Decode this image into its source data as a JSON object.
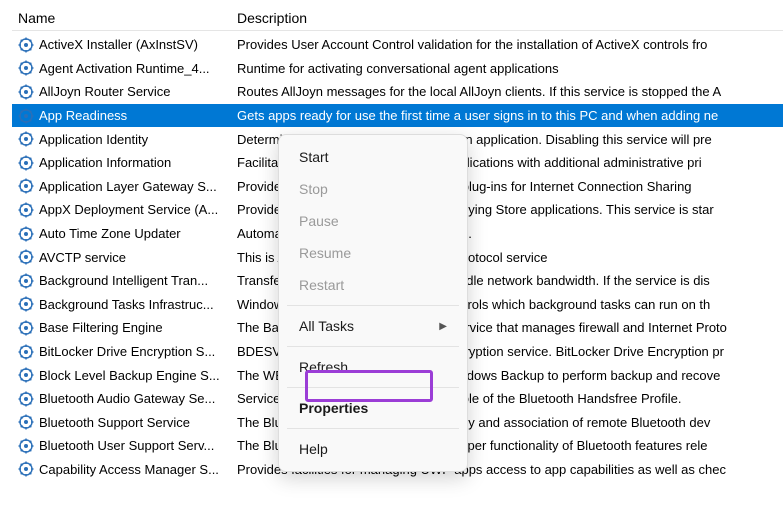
{
  "columns": {
    "name": "Name",
    "description": "Description"
  },
  "services": [
    {
      "name": "ActiveX Installer (AxInstSV)",
      "description": "Provides User Account Control validation for the installation of ActiveX controls fro"
    },
    {
      "name": "Agent Activation Runtime_4...",
      "description": "Runtime for activating conversational agent applications"
    },
    {
      "name": "AllJoyn Router Service",
      "description": "Routes AllJoyn messages for the local AllJoyn clients. If this service is stopped the A"
    },
    {
      "name": "App Readiness",
      "description": "Gets apps ready for use the first time a user signs in to this PC and when adding ne",
      "selected": true
    },
    {
      "name": "Application Identity",
      "description": "Determines and verifies the identity of an application. Disabling this service will pre"
    },
    {
      "name": "Application Information",
      "description": "Facilitates the running of interactive applications with additional administrative pri"
    },
    {
      "name": "Application Layer Gateway S...",
      "description": "Provides support for 3rd party protocol plug-ins for Internet Connection Sharing"
    },
    {
      "name": "AppX Deployment Service (A...",
      "description": "Provides infrastructure support for deploying Store applications. This service is star"
    },
    {
      "name": "Auto Time Zone Updater",
      "description": "Automatically sets the system time zone."
    },
    {
      "name": "AVCTP service",
      "description": "This is Audio Video Control Transport Protocol service"
    },
    {
      "name": "Background Intelligent Tran...",
      "description": "Transfers files in the background using idle network bandwidth. If the service is dis"
    },
    {
      "name": "Background Tasks Infrastruc...",
      "description": "Windows infrastructure service that controls which background tasks can run on th"
    },
    {
      "name": "Base Filtering Engine",
      "description": "The Base Filtering Engine (BFE) is a service that manages firewall and Internet Proto"
    },
    {
      "name": "BitLocker Drive Encryption S...",
      "description": "BDESVC hosts the BitLocker Drive Encryption service. BitLocker Drive Encryption pr"
    },
    {
      "name": "Block Level Backup Engine S...",
      "description": "The WBENGINE service is used by Windows Backup to perform backup and recove"
    },
    {
      "name": "Bluetooth Audio Gateway Se...",
      "description": "Service supporting the audio gateway role of the Bluetooth Handsfree Profile."
    },
    {
      "name": "Bluetooth Support Service",
      "description": "The Bluetooth service supports discovery and association of remote Bluetooth dev"
    },
    {
      "name": "Bluetooth User Support Serv...",
      "description": "The Bluetooth user service supports proper functionality of Bluetooth features rele"
    },
    {
      "name": "Capability Access Manager S...",
      "description": "Provides facilities for managing UWP apps access to app capabilities as well as chec"
    }
  ],
  "context_menu": {
    "start": "Start",
    "stop": "Stop",
    "pause": "Pause",
    "resume": "Resume",
    "restart": "Restart",
    "all_tasks": "All Tasks",
    "refresh": "Refresh",
    "properties": "Properties",
    "help": "Help"
  }
}
